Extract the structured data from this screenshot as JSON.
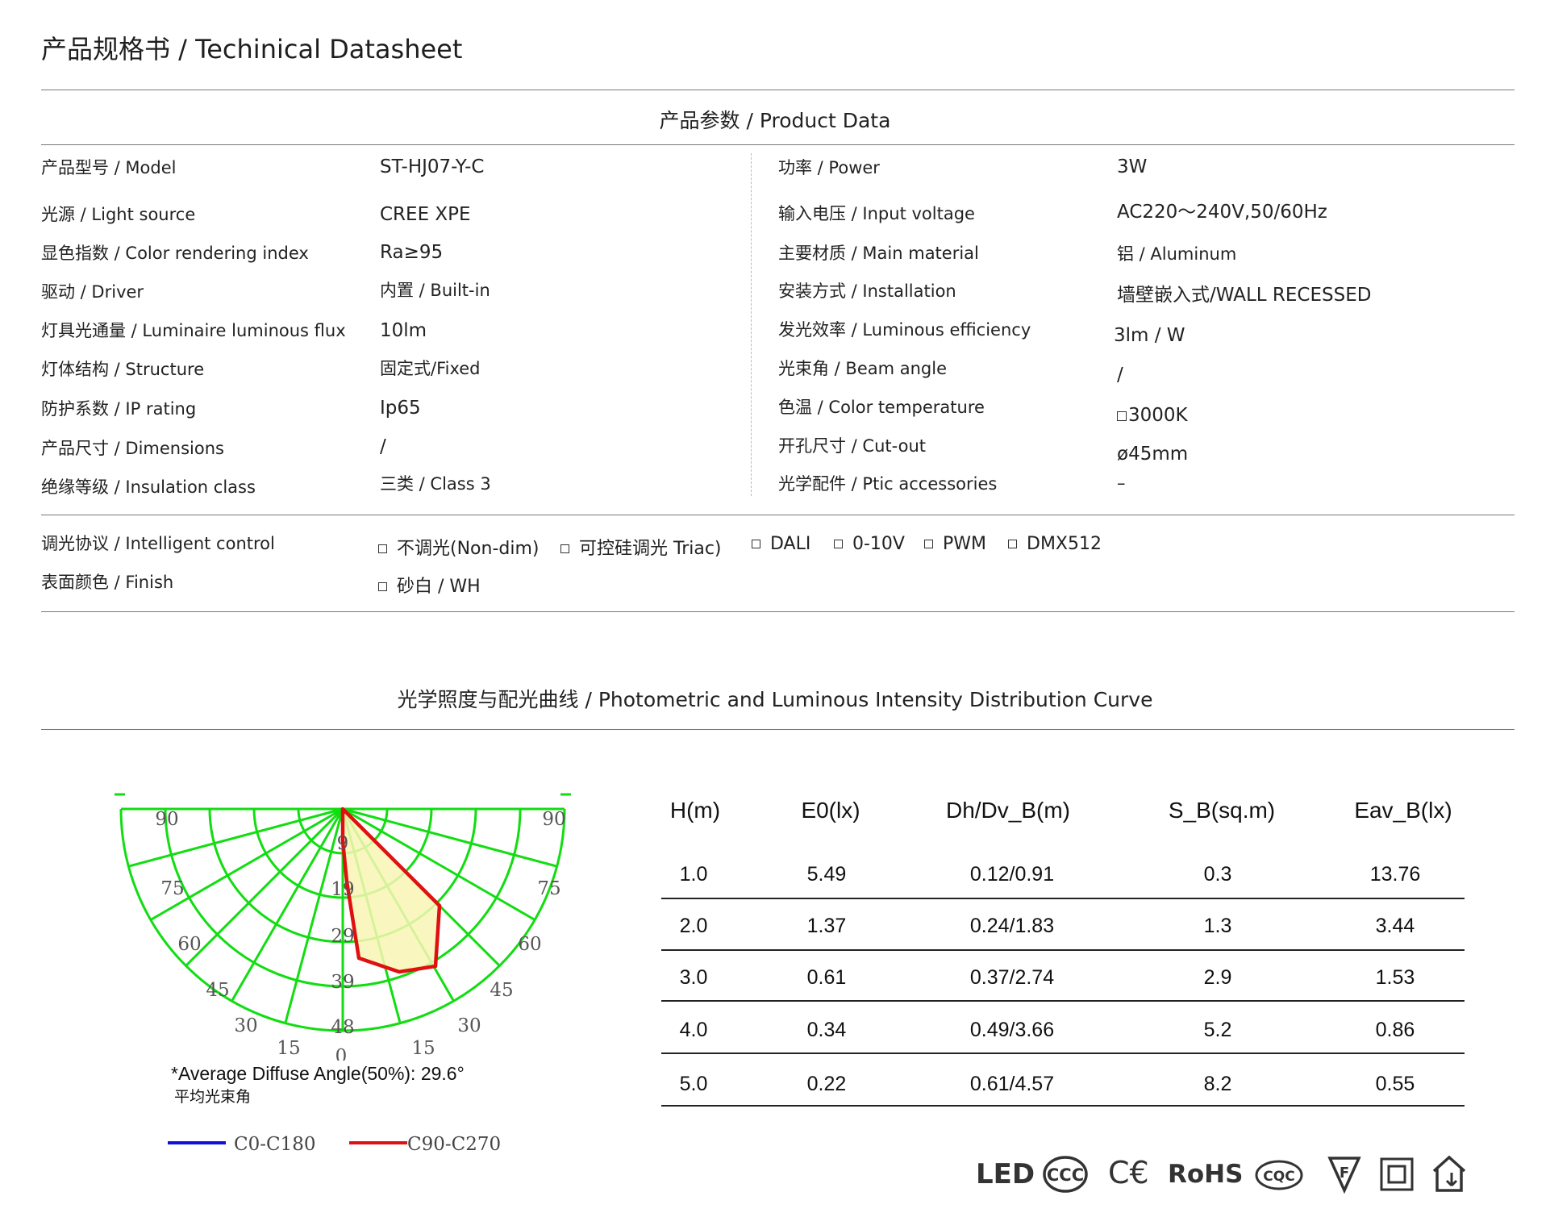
{
  "header": {
    "title": "产品规格书 / Techinical Datasheet"
  },
  "product_section": {
    "title": "产品参数 / Product Data"
  },
  "specs_left": [
    {
      "label": "产品型号 / Model",
      "value": "ST-HJ07-Y-C"
    },
    {
      "label": "光源 / Light source",
      "value": "CREE XPE"
    },
    {
      "label": "显色指数 / Color rendering index",
      "value": "Ra≥95"
    },
    {
      "label": "驱动 / Driver",
      "value": "内置 / Built-in"
    },
    {
      "label": "灯具光通量 / Luminaire luminous flux",
      "value": "10lm"
    },
    {
      "label": "灯体结构 / Structure",
      "value": "固定式/Fixed"
    },
    {
      "label": "防护系数 / IP rating",
      "value": "Ip65"
    },
    {
      "label": "产品尺寸 / Dimensions",
      "value": "/"
    },
    {
      "label": "绝缘等级 / Insulation class",
      "value": "三类 / Class 3"
    }
  ],
  "specs_right": [
    {
      "label": "功率 / Power",
      "value": "3W"
    },
    {
      "label": "输入电压 / Input voltage",
      "value": "AC220～240V,50/60Hz"
    },
    {
      "label": "主要材质 / Main material",
      "value": "铝 / Aluminum"
    },
    {
      "label": "安装方式 / Installation",
      "value": "墙壁嵌入式/WALL RECESSED"
    },
    {
      "label": "发光效率 / Luminous efficiency",
      "value": "3lm / W"
    },
    {
      "label": "光束角 / Beam angle",
      "value": "/"
    },
    {
      "label": "色温 / Color temperature",
      "value": "3000K"
    },
    {
      "label": "开孔尺寸 / Cut-out",
      "value": "ø45mm"
    },
    {
      "label": "光学配件 / Ptic accessories",
      "value": "–"
    }
  ],
  "control": {
    "label": "调光协议 / Intelligent control",
    "options": [
      "不调光(Non-dim)",
      "可控硅调光 Triac)",
      "DALI",
      "0-10V",
      "PWM",
      "DMX512"
    ]
  },
  "finish": {
    "label": "表面颜色 / Finish",
    "options": [
      "砂白 / WH"
    ]
  },
  "photometric_section": {
    "title": "光学照度与配光曲线 / Photometric and Luminous Intensity Distribution Curve"
  },
  "polar": {
    "angle_labels_left": [
      "90",
      "75",
      "60",
      "45",
      "30",
      "15"
    ],
    "angle_labels_right": [
      "90",
      "75",
      "60",
      "45",
      "30",
      "15"
    ],
    "bottom_label": "0",
    "radial_labels": [
      "9",
      "19",
      "29",
      "39",
      "48"
    ],
    "note_en": "*Average Diffuse Angle(50%): 29.6°",
    "note_cn": "平均光束角",
    "legend": [
      {
        "label": "C0-C180",
        "color": "#1010e0"
      },
      {
        "label": "C90-C270",
        "color": "#e01010"
      }
    ],
    "grid_color": "#11dd11",
    "fill_color": "#f8f6b4"
  },
  "illuminance_table": {
    "headers": [
      "H(m)",
      "E0(lx)",
      "Dh/Dv_B(m)",
      "S_B(sq.m)",
      "Eav_B(lx)"
    ],
    "rows": [
      [
        "1.0",
        "5.49",
        "0.12/0.91",
        "0.3",
        "13.76"
      ],
      [
        "2.0",
        "1.37",
        "0.24/1.83",
        "1.3",
        "3.44"
      ],
      [
        "3.0",
        "0.61",
        "0.37/2.74",
        "2.9",
        "1.53"
      ],
      [
        "4.0",
        "0.34",
        "0.49/3.66",
        "5.2",
        "0.86"
      ],
      [
        "5.0",
        "0.22",
        "0.61/4.57",
        "8.2",
        "0.55"
      ]
    ]
  },
  "certifications": [
    "LED",
    "CCC",
    "CE",
    "RoHS",
    "CQC",
    "F",
    "class-II",
    "indoor"
  ]
}
